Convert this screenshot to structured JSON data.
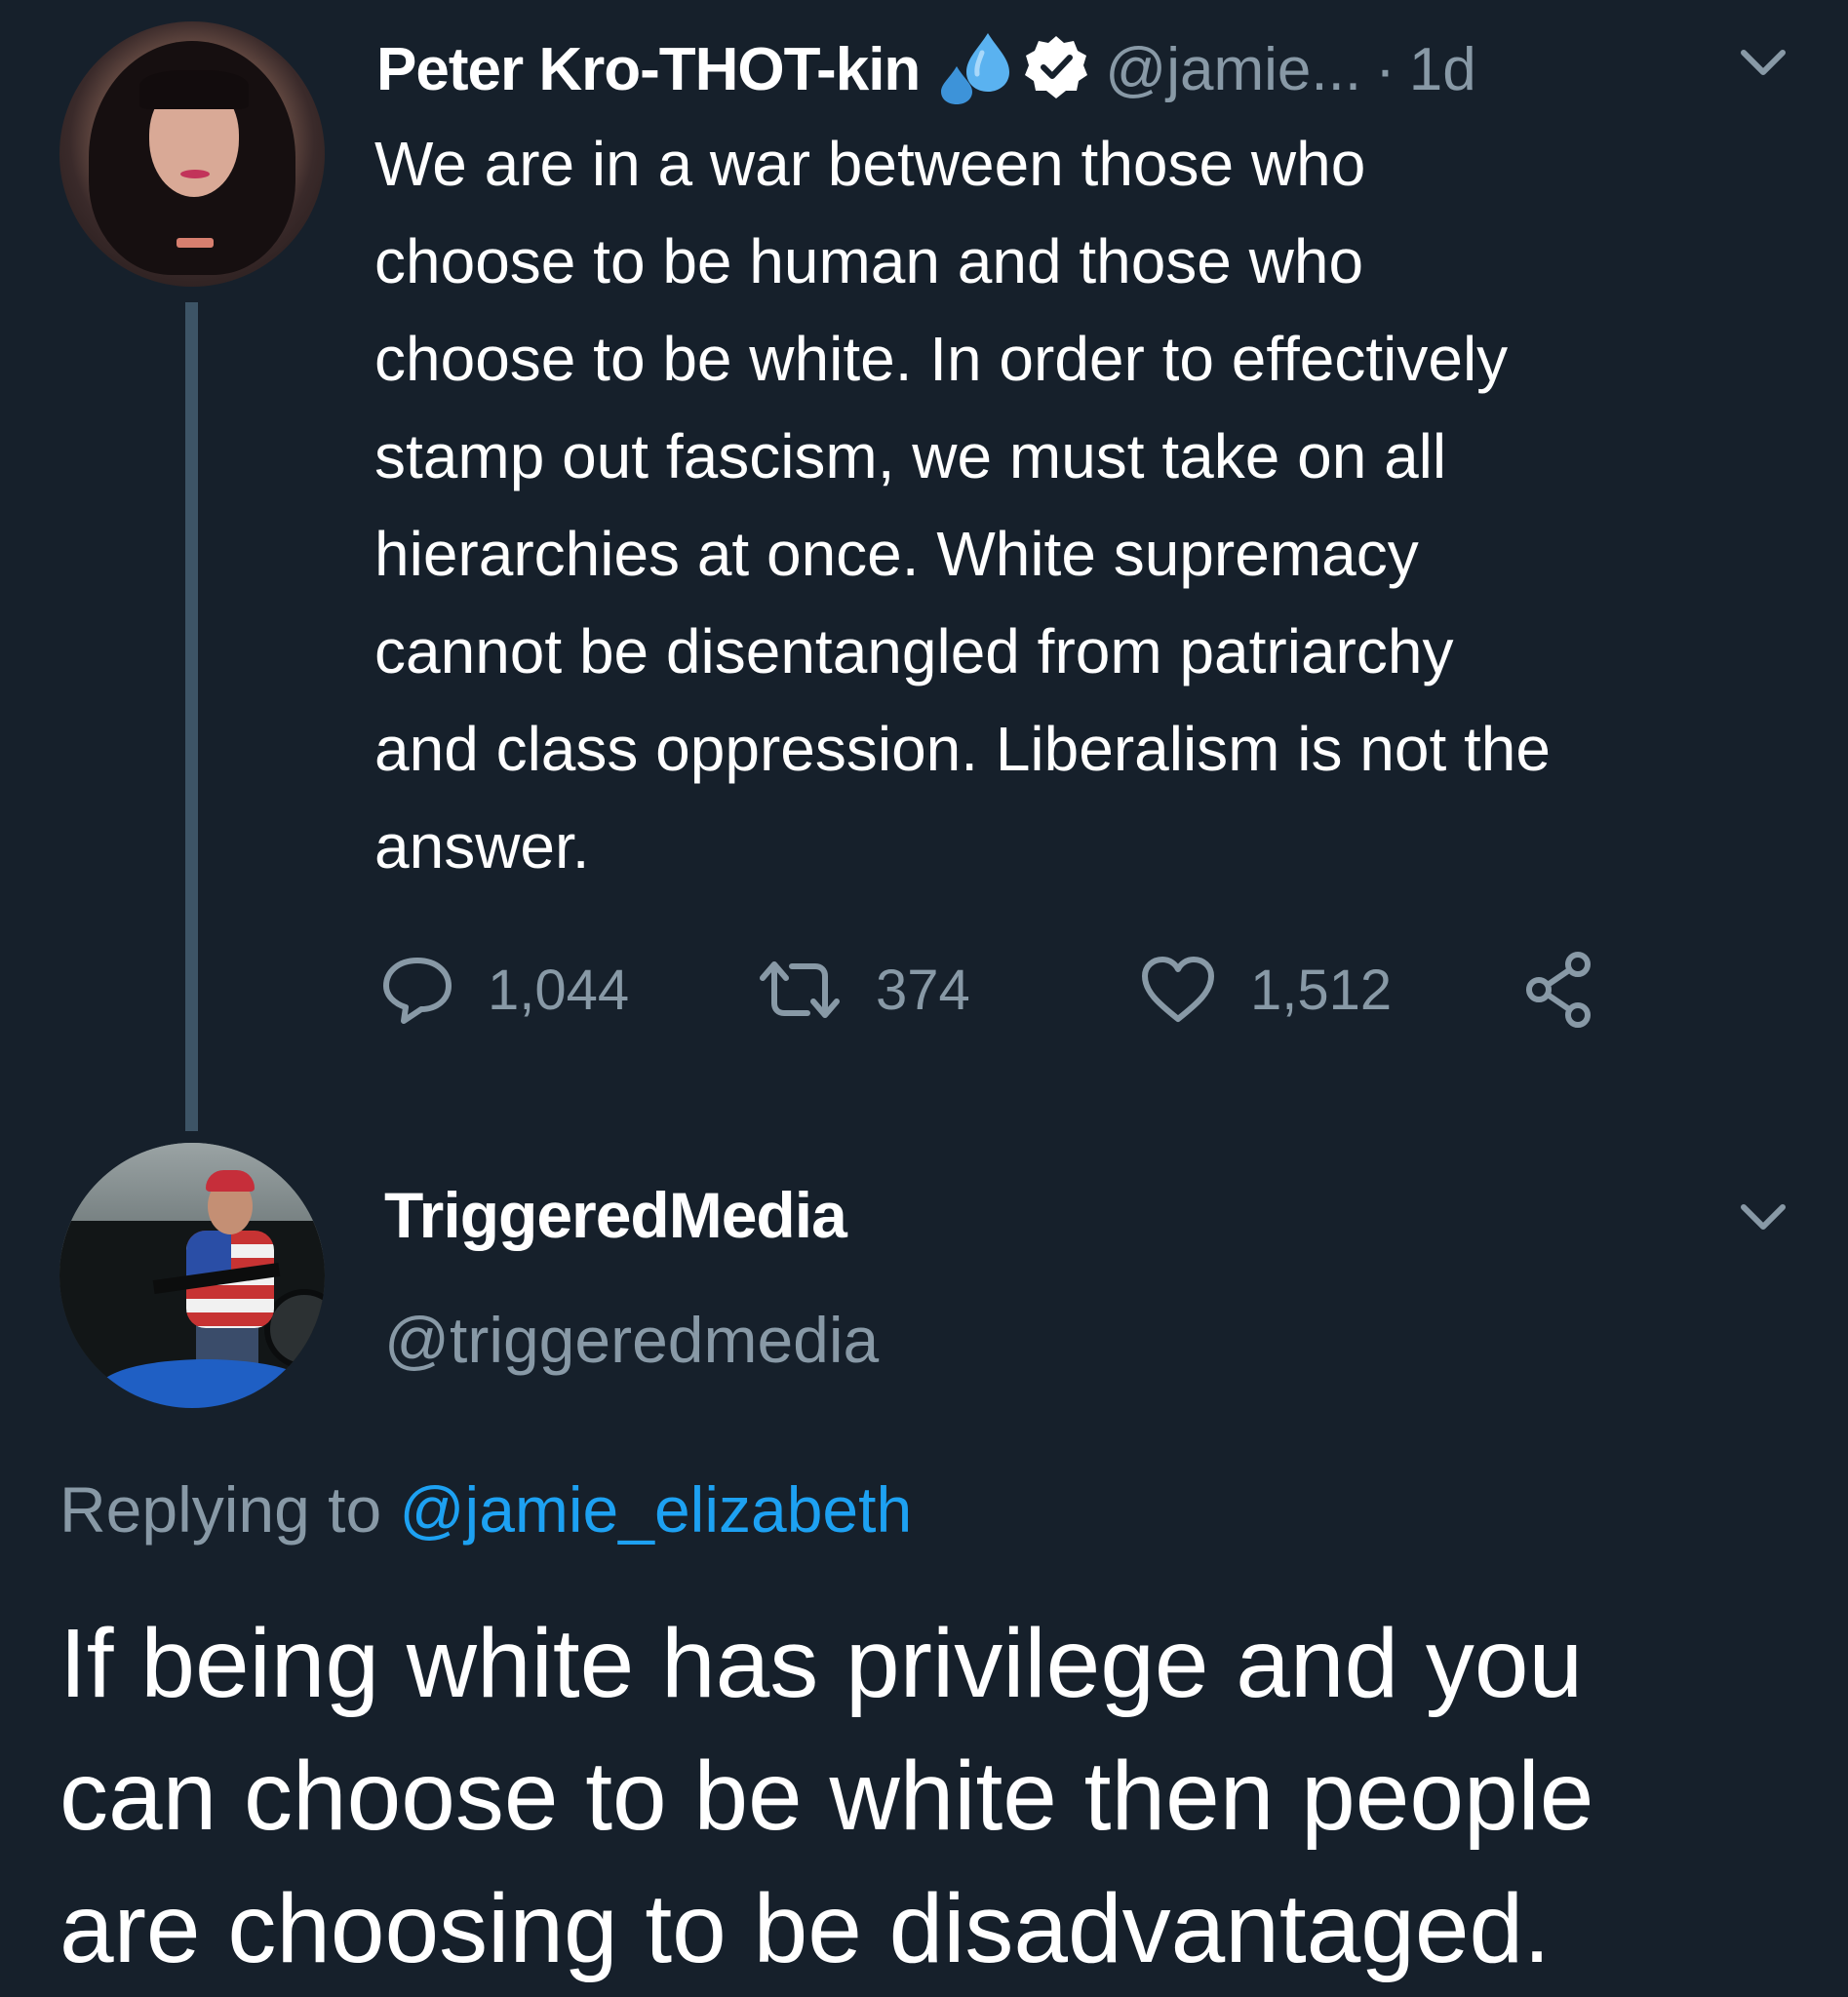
{
  "colors": {
    "background": "#16202b",
    "primary_text": "#ffffff",
    "secondary_text": "#8899a6",
    "link": "#1da1f2",
    "thread_line": "#3d5466"
  },
  "original_tweet": {
    "display_name": "Peter Kro-THOT-kin",
    "name_emoji": "sweat-droplets-icon",
    "verified": true,
    "handle": "@jamie...",
    "separator": "·",
    "timestamp": "1d",
    "text": "We are in a war between those who\nchoose to be human and those who\nchoose to be white. In order to effectively\nstamp out fascism, we must take on all\nhierarchies at once. White supremacy\ncannot be disentangled from patriarchy\nand class oppression. Liberalism is not the\nanswer.",
    "actions": {
      "reply_icon": "speech-bubble-icon",
      "reply_count": "1,044",
      "retweet_icon": "retweet-icon",
      "retweet_count": "374",
      "like_icon": "heart-icon",
      "like_count": "1,512",
      "share_icon": "share-icon"
    }
  },
  "reply_tweet": {
    "display_name": "TriggeredMedia",
    "handle": "@triggeredmedia",
    "replying_label": "Replying to",
    "replying_to": "@jamie_elizabeth",
    "text": "If being white has privilege and you\ncan choose to be white then people\nare choosing to be disadvantaged."
  }
}
